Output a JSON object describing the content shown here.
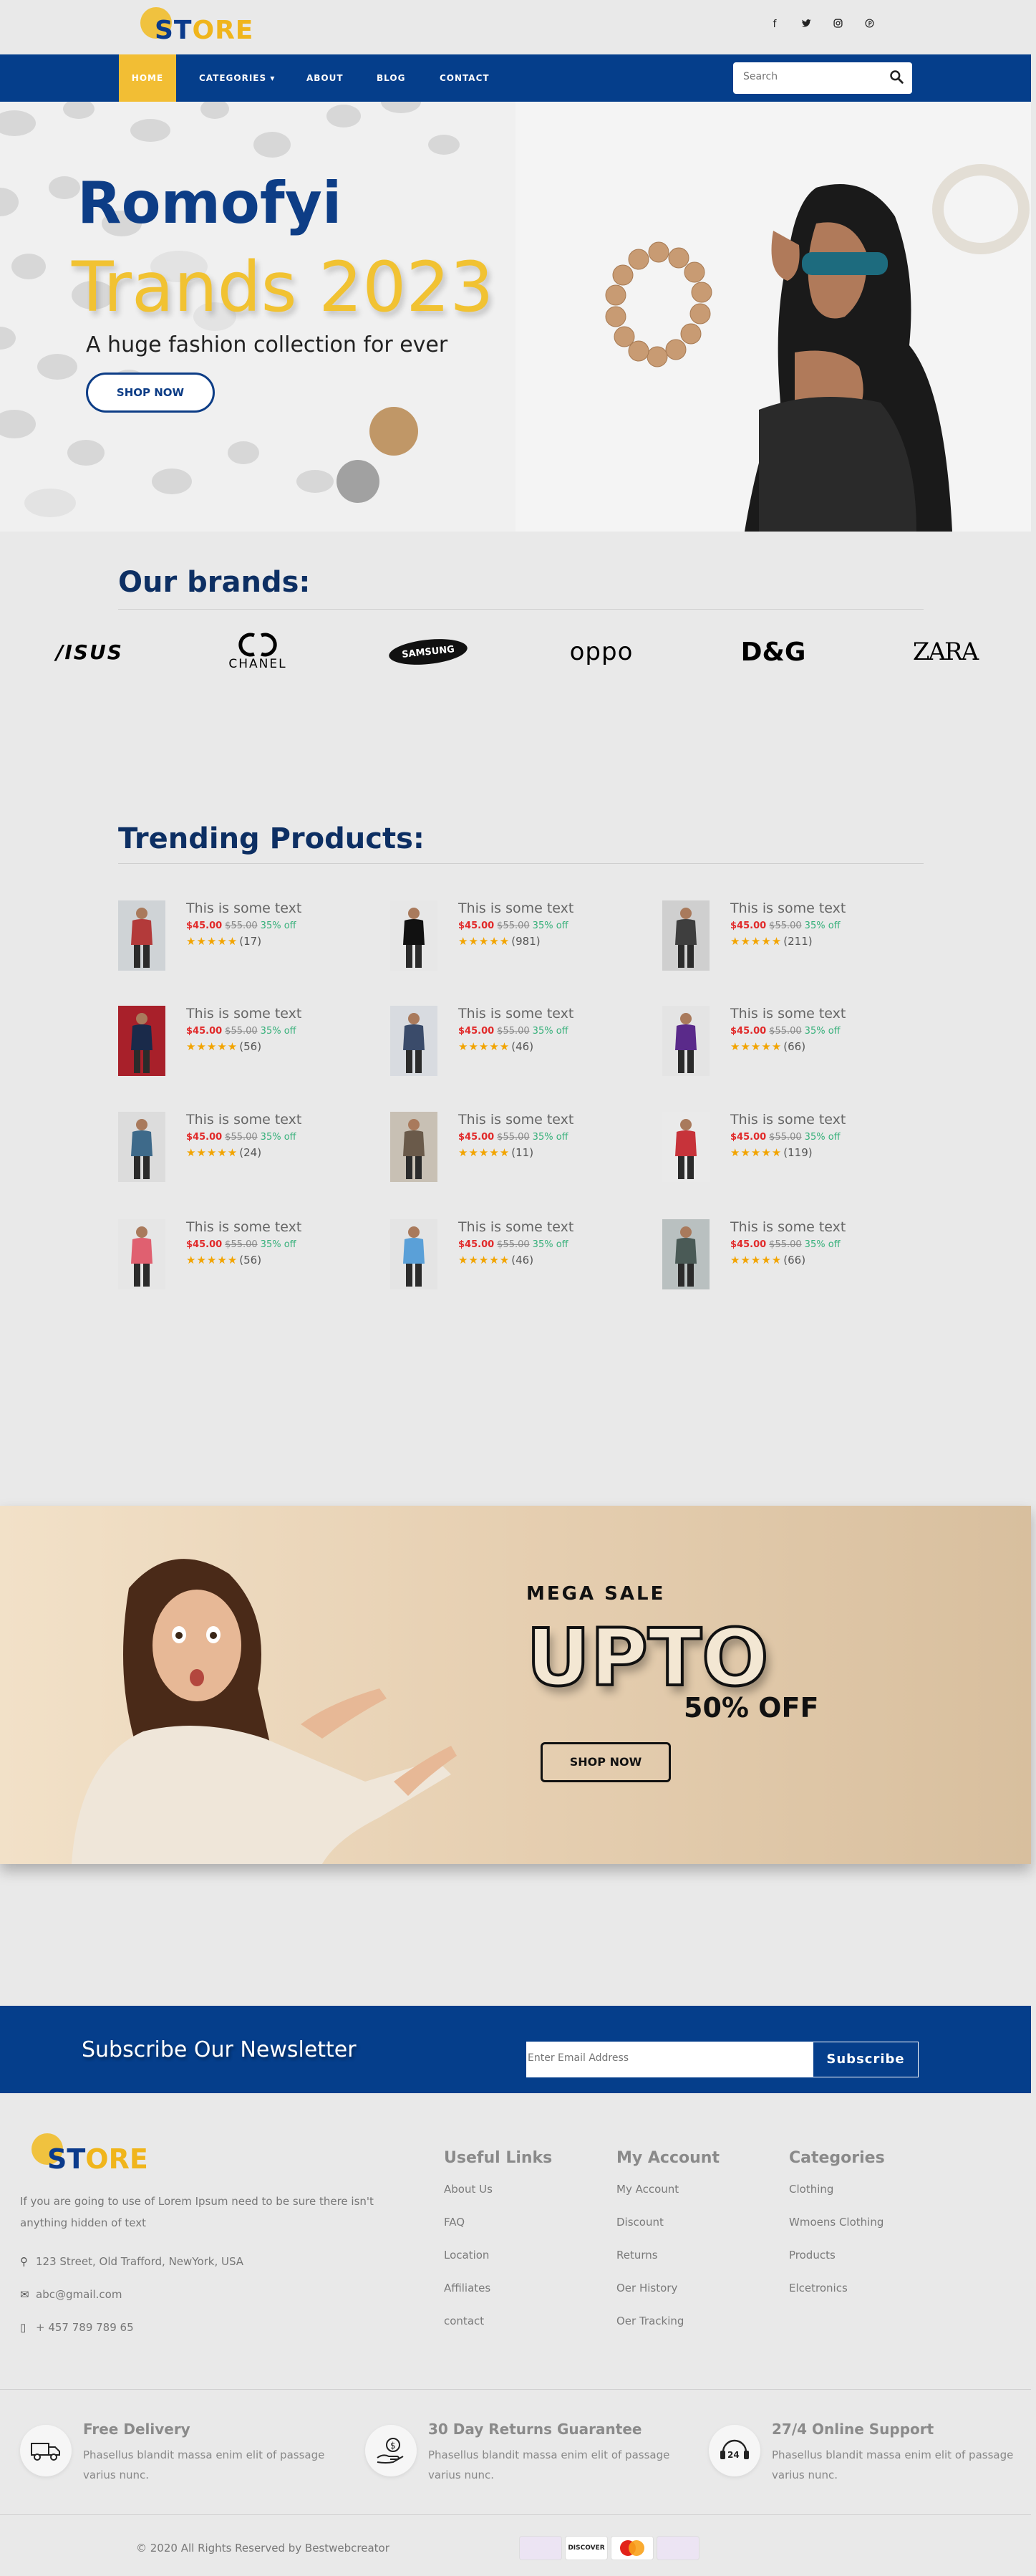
{
  "header": {
    "logo_prefix": "ST",
    "logo_accent": "ORE",
    "socials": [
      "facebook-icon",
      "twitter-icon",
      "instagram-icon",
      "pinterest-icon"
    ]
  },
  "nav": {
    "items": [
      {
        "label": "HOME",
        "active": true
      },
      {
        "label": "CATEGORIES ▾"
      },
      {
        "label": "ABOUT"
      },
      {
        "label": "BLOG"
      },
      {
        "label": "CONTACT"
      }
    ],
    "search_placeholder": "Search"
  },
  "hero": {
    "title": "Romofyi",
    "subtitle_big": "Trands 2023",
    "tagline": "A huge fashion collection for ever",
    "button": "SHOP NOW"
  },
  "brands": {
    "title": "Our brands:",
    "items": [
      "/ISUS",
      "CHANEL",
      "SAMSUNG",
      "oppo",
      "D&G",
      "ZARA"
    ]
  },
  "trending": {
    "title": "Trending Products:",
    "products": [
      {
        "name": "This is some text",
        "price": "$45.00",
        "old_price": "$55.00",
        "discount": "35% off",
        "stars": "★★★★★",
        "count": "(17)"
      },
      {
        "name": "This is some text",
        "price": "$45.00",
        "old_price": "$55.00",
        "discount": "35% off",
        "stars": "★★★★★",
        "count": "(981)"
      },
      {
        "name": "This is some text",
        "price": "$45.00",
        "old_price": "$55.00",
        "discount": "35% off",
        "stars": "★★★★★",
        "count": "(211)"
      },
      {
        "name": "This is some text",
        "price": "$45.00",
        "old_price": "$55.00",
        "discount": "35% off",
        "stars": "★★★★★",
        "count": "(56)"
      },
      {
        "name": "This is some text",
        "price": "$45.00",
        "old_price": "$55.00",
        "discount": "35% off",
        "stars": "★★★★★",
        "count": "(46)"
      },
      {
        "name": "This is some text",
        "price": "$45.00",
        "old_price": "$55.00",
        "discount": "35% off",
        "stars": "★★★★★",
        "count": "(66)"
      },
      {
        "name": "This is some text",
        "price": "$45.00",
        "old_price": "$55.00",
        "discount": "35% off",
        "stars": "★★★★★",
        "count": "(24)"
      },
      {
        "name": "This is some text",
        "price": "$45.00",
        "old_price": "$55.00",
        "discount": "35% off",
        "stars": "★★★★★",
        "count": "(11)"
      },
      {
        "name": "This is some text",
        "price": "$45.00",
        "old_price": "$55.00",
        "discount": "35% off",
        "stars": "★★★★★",
        "count": "(119)"
      },
      {
        "name": "This is some text",
        "price": "$45.00",
        "old_price": "$55.00",
        "discount": "35% off",
        "stars": "★★★★★",
        "count": "(56)"
      },
      {
        "name": "This is some text",
        "price": "$45.00",
        "old_price": "$55.00",
        "discount": "35% off",
        "stars": "★★★★★",
        "count": "(46)"
      },
      {
        "name": "This is some text",
        "price": "$45.00",
        "old_price": "$55.00",
        "discount": "35% off",
        "stars": "★★★★★",
        "count": "(66)"
      }
    ]
  },
  "sale": {
    "eyebrow": "MEGA SALE",
    "headline": "UPTO",
    "percent": "50% OFF",
    "button": "SHOP NOW"
  },
  "newsletter": {
    "title": "Subscribe Our Newsletter",
    "placeholder": "Enter Email Address",
    "button": "Subscribe"
  },
  "footer": {
    "description": "If you are going to use of Lorem Ipsum need to be sure there isn't anything hidden of text",
    "address": "123 Street, Old Trafford, NewYork, USA",
    "email": "abc@gmail.com",
    "phone": "+ 457 789 789 65",
    "columns": [
      {
        "title": "Useful Links",
        "links": [
          "About Us",
          "FAQ",
          "Location",
          "Affiliates",
          "contact"
        ]
      },
      {
        "title": "My Account",
        "links": [
          "My Account",
          "Discount",
          "Returns",
          "Oer History",
          "Oer Tracking"
        ]
      },
      {
        "title": "Categories",
        "links": [
          "Clothing",
          "Wmoens Clothing",
          "Products",
          "Elcetronics"
        ]
      }
    ],
    "features": [
      {
        "title": "Free Delivery",
        "text": "Phasellus blandit massa enim elit of passage varius nunc.",
        "icon": "truck-icon"
      },
      {
        "title": "30 Day Returns Guarantee",
        "text": "Phasellus blandit massa enim elit of passage varius nunc.",
        "icon": "money-hand-icon"
      },
      {
        "title": "27/4 Online Support",
        "text": "Phasellus blandit massa enim elit of passage varius nunc.",
        "icon": "support-24-icon"
      }
    ],
    "copyright": "© 2020 All Rights Reserved by Bestwebcreator",
    "payments": [
      "",
      "DISCOVER",
      "MasterCard",
      ""
    ]
  }
}
